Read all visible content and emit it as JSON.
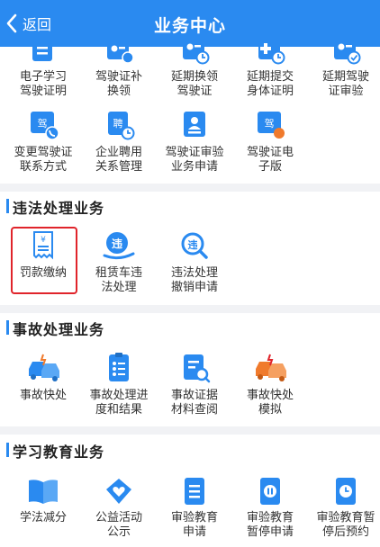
{
  "header": {
    "back_label": "返回",
    "title": "业务中心"
  },
  "license": {
    "row1": [
      "电子学习\n驾驶证明",
      "驾驶证补\n换领",
      "延期换领\n驾驶证",
      "延期提交\n身体证明",
      "延期驾驶\n证审验"
    ],
    "row2": [
      "变更驾驶证\n联系方式",
      "企业聘用\n关系管理",
      "驾驶证审验\n业务申请",
      "驾驶证电\n子版"
    ]
  },
  "violation": {
    "title": "违法处理业务",
    "items": [
      "罚款缴纳",
      "租赁车违\n法处理",
      "违法处理\n撤销申请"
    ]
  },
  "accident": {
    "title": "事故处理业务",
    "items": [
      "事故快处",
      "事故处理进\n度和结果",
      "事故证据\n材料查阅",
      "事故快处\n模拟"
    ]
  },
  "education": {
    "title": "学习教育业务",
    "items": [
      "学法减分",
      "公益活动\n公示",
      "审验教育\n申请",
      "审验教育\n暂停申请",
      "审验教育暂\n停后预约"
    ]
  },
  "icons": {
    "primary": "#2a8af0",
    "accent": "#f07a2c",
    "highlight": "#e0242b"
  }
}
